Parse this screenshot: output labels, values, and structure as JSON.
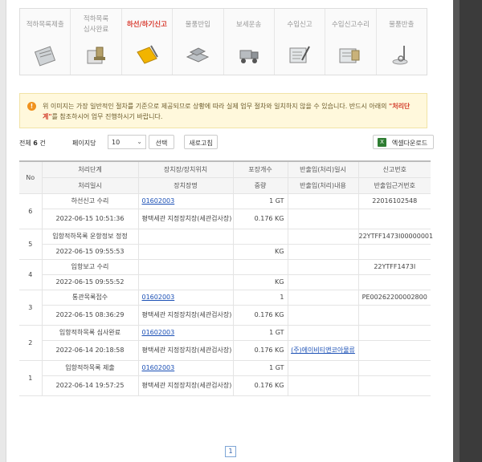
{
  "steps": [
    {
      "label": "적하목록제출",
      "icon": "clipboard-icon",
      "active": false
    },
    {
      "label": "적하목록\n심사완료",
      "icon": "stamp-icon",
      "active": false
    },
    {
      "label": "하선/하기신고",
      "icon": "folder-icon",
      "active": true
    },
    {
      "label": "물품반입",
      "icon": "cargo-in-icon",
      "active": false
    },
    {
      "label": "보세운송",
      "icon": "forklift-icon",
      "active": false
    },
    {
      "label": "수입신고",
      "icon": "document-pen-icon",
      "active": false
    },
    {
      "label": "수입신고수리",
      "icon": "document-approve-icon",
      "active": false
    },
    {
      "label": "물품반출",
      "icon": "release-icon",
      "active": false
    }
  ],
  "notice": {
    "text_before": "위 이미지는 가장 일반적인 절차를 기준으로 제공되므로 상황에 따라 실제 업무 절차와 일치하지 않을 수 있습니다. 반드시 아래의 ",
    "highlight": "\"처리단계\"",
    "text_after": "를 참조하시어 업무 진행하시기 바랍니다."
  },
  "toolbar": {
    "total_label": "전체",
    "total_count": "6",
    "total_unit": "건",
    "page_size_label": "페이지당",
    "page_size_value": "10",
    "select_button": "선택",
    "refresh_button": "새로고침",
    "excel_button": "엑셀다운로드"
  },
  "table": {
    "headers_top": [
      "No",
      "처리단계",
      "장치장/장치위치",
      "포장개수",
      "반출입(처리)일시",
      "신고번호"
    ],
    "headers_bottom": [
      "처리일시",
      "장치장명",
      "중량",
      "반출입(처리)내용",
      "반출입근거번호"
    ],
    "rows": [
      {
        "no": "6",
        "step": "하선신고 수리",
        "location_code": "01602003",
        "packages": "1 GT",
        "io_datetime": "",
        "report_no": "22016102548",
        "datetime": "2022-06-15 10:51:36",
        "location_name": "평택세관 지정장치장(세관검사장)",
        "weight": "0.176 KG",
        "io_content": "",
        "basis_no": ""
      },
      {
        "no": "5",
        "step": "입항적하목록 운항정보 정정",
        "location_code": "",
        "packages": "",
        "io_datetime": "",
        "report_no": "22YTFF1473I00000001",
        "datetime": "2022-06-15 09:55:53",
        "location_name": "",
        "weight": "KG",
        "io_content": "",
        "basis_no": ""
      },
      {
        "no": "4",
        "step": "입항보고 수리",
        "location_code": "",
        "packages": "",
        "io_datetime": "",
        "report_no": "22YTFF1473I",
        "datetime": "2022-06-15 09:55:52",
        "location_name": "",
        "weight": "KG",
        "io_content": "",
        "basis_no": ""
      },
      {
        "no": "3",
        "step": "통관목록접수",
        "location_code": "01602003",
        "packages": "1",
        "io_datetime": "",
        "report_no": "PE00262200002800",
        "datetime": "2022-06-15 08:36:29",
        "location_name": "평택세관 지정장치장(세관검사장)",
        "weight": "0.176 KG",
        "io_content": "",
        "basis_no": ""
      },
      {
        "no": "2",
        "step": "입항적하목록 심사완료",
        "location_code": "01602003",
        "packages": "1 GT",
        "io_datetime": "",
        "report_no": "",
        "datetime": "2022-06-14 20:18:58",
        "location_name": "평택세관 지정장치장(세관검사장)",
        "weight": "0.176 KG",
        "io_content": "(주)에이비티앤코아물류",
        "basis_no": ""
      },
      {
        "no": "1",
        "step": "입항적하목록 제출",
        "location_code": "01602003",
        "packages": "1 GT",
        "io_datetime": "",
        "report_no": "",
        "datetime": "2022-06-14 19:57:25",
        "location_name": "평택세관 지정장치장(세관검사장)",
        "weight": "0.176 KG",
        "io_content": "",
        "basis_no": ""
      }
    ]
  },
  "pagination": {
    "current": "1"
  }
}
